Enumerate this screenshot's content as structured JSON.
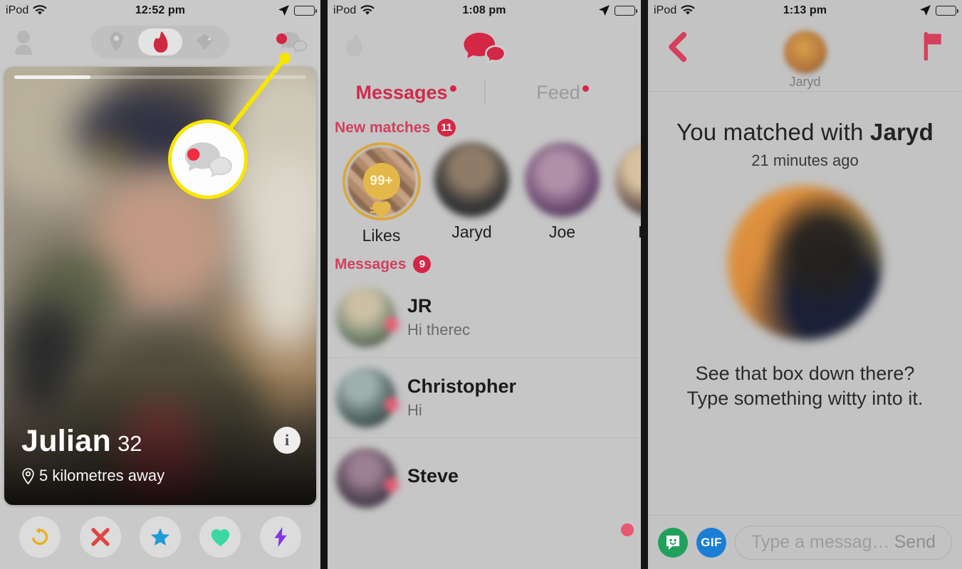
{
  "panel1": {
    "status": {
      "carrier": "iPod",
      "time": "12:52 pm",
      "wifi_icon": "wifi-icon",
      "location_icon": "location-arrow-icon",
      "battery_icon": "battery-icon"
    },
    "nav": {
      "profile_icon": "person-icon",
      "tabs": [
        {
          "icon": "location-pin-icon",
          "name": "explore",
          "active": false
        },
        {
          "icon": "tinder-flame-icon",
          "name": "swipe",
          "active": true
        },
        {
          "icon": "diamond-icon",
          "name": "top-picks",
          "active": false
        }
      ],
      "messages_icon": "chat-bubbles-icon",
      "messages_has_badge": true
    },
    "callout": {
      "icon": "chat-bubbles-icon",
      "color": "#f7e600"
    },
    "card": {
      "name": "Julian",
      "age": "32",
      "distance": "5 kilometres away",
      "distance_icon": "location-pin-icon",
      "info_button": "i",
      "photo_progress_segments": 1
    },
    "actions": [
      {
        "name": "rewind-button",
        "icon": "rewind-icon",
        "color": "#e8b11c"
      },
      {
        "name": "nope-button",
        "icon": "x-icon",
        "color": "#e0453f"
      },
      {
        "name": "superlike-button",
        "icon": "star-icon",
        "color": "#1f9bd8"
      },
      {
        "name": "like-button",
        "icon": "heart-icon",
        "color": "#3ad9a4"
      },
      {
        "name": "boost-button",
        "icon": "lightning-icon",
        "color": "#8235e8"
      }
    ]
  },
  "panel2": {
    "status": {
      "carrier": "iPod",
      "time": "1:08 pm"
    },
    "nav": {
      "flame_icon": "tinder-flame-icon",
      "logo_icon": "chat-bubbles-icon"
    },
    "tabs": [
      {
        "label": "Messages",
        "active": true,
        "has_dot": true
      },
      {
        "label": "Feed",
        "active": false,
        "has_dot": true
      }
    ],
    "new_matches": {
      "label": "New matches",
      "count": "11"
    },
    "matches": [
      {
        "name": "Likes",
        "type": "likes",
        "count": "99+",
        "heart_icon": "heart-icon"
      },
      {
        "name": "Jaryd",
        "type": "person",
        "unread": true
      },
      {
        "name": "Joe",
        "type": "person",
        "unread": true
      },
      {
        "name": "Dav",
        "type": "person",
        "unread": false
      }
    ],
    "messages_section": {
      "label": "Messages",
      "count": "9"
    },
    "conversations": [
      {
        "name": "JR",
        "preview": "Hi therec",
        "unread": true
      },
      {
        "name": "Christopher",
        "preview": "Hi",
        "unread": true
      },
      {
        "name": "Steve",
        "preview": "",
        "unread": true
      }
    ]
  },
  "panel3": {
    "status": {
      "carrier": "iPod",
      "time": "1:13 pm"
    },
    "nav": {
      "back_icon": "chevron-left-icon",
      "name": "Jaryd",
      "report_icon": "flag-icon"
    },
    "match": {
      "headline_prefix": "You matched with ",
      "headline_name": "Jaryd",
      "time_ago": "21 minutes ago",
      "hint": "See that box down there? Type something witty into it."
    },
    "composer": {
      "sticker_icon": "sticker-smiley-icon",
      "gif_label": "GIF",
      "placeholder": "Type a messag…",
      "send_label": "Send"
    }
  },
  "colors": {
    "tinder_red": "#d42645",
    "accent_yellow": "#f7e600",
    "muted_gray": "#9b9b9b"
  }
}
